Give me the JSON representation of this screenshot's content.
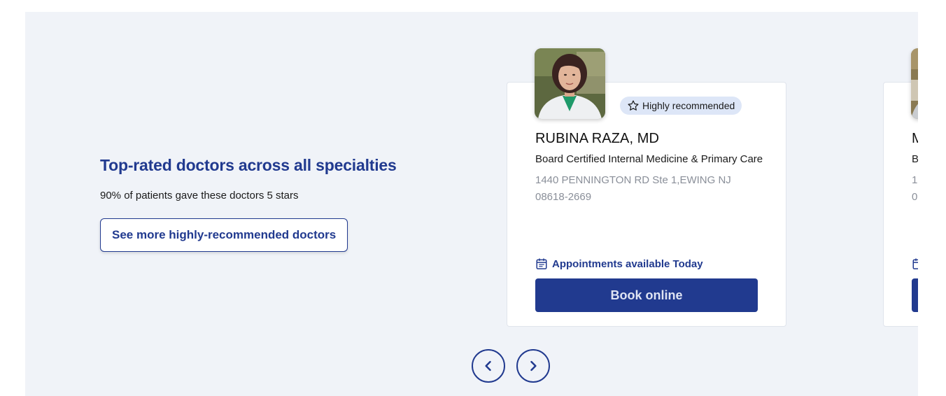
{
  "intro": {
    "title": "Top-rated doctors across all specialties",
    "subtitle": "90% of patients gave these doctors 5 stars",
    "see_more_label": "See more highly-recommended doctors"
  },
  "cards": [
    {
      "badge": "Highly recommended",
      "name": "RUBINA RAZA, MD",
      "specialty": "Board Certified Internal Medicine & Primary Care",
      "address": "1440 PENNINGTON RD Ste 1,EWING NJ 08618-2669",
      "availability": "Appointments available Today",
      "book_label": "Book online"
    },
    {
      "name": "M",
      "specialty": "B",
      "address_line1": "1",
      "address_line2": "0"
    }
  ],
  "colors": {
    "brand": "#213a8f",
    "section_bg": "#f0f3f8",
    "badge_bg": "#dde6f7",
    "muted_text": "#8a8f99"
  },
  "icons": {
    "badge": "star-outline-icon",
    "availability": "calendar-icon",
    "prev": "chevron-left-icon",
    "next": "chevron-right-icon"
  }
}
